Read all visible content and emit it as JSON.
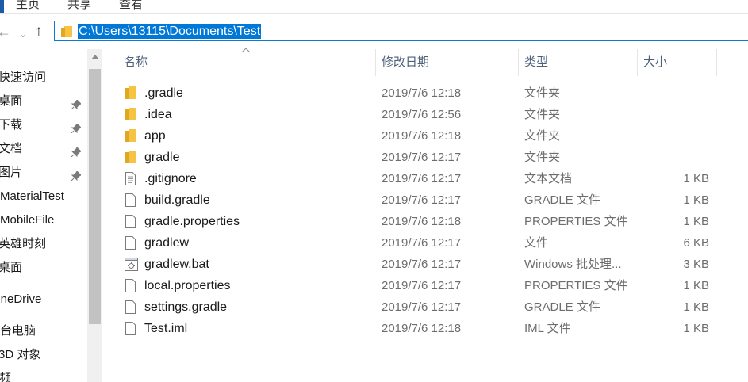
{
  "ribbon": {
    "tabs": [
      "主页",
      "共享",
      "查看"
    ]
  },
  "address": {
    "path": "C:\\Users\\13115\\Documents\\Test"
  },
  "nav_pane": {
    "items": [
      {
        "label": "快速访问",
        "pinned": false
      },
      {
        "label": "桌面",
        "pinned": true
      },
      {
        "label": "下载",
        "pinned": true
      },
      {
        "label": "文档",
        "pinned": true
      },
      {
        "label": "图片",
        "pinned": true
      },
      {
        "label": "MaterialTest",
        "pinned": false
      },
      {
        "label": "MobileFile",
        "pinned": false
      },
      {
        "label": "英雄时刻",
        "pinned": false
      },
      {
        "label": "桌面",
        "pinned": false
      },
      {
        "label": "OneDrive",
        "pinned": false
      },
      {
        "label": "此台电脑",
        "pinned": false
      },
      {
        "label": "3D 对象",
        "pinned": false
      },
      {
        "label": "视频",
        "pinned": false
      }
    ]
  },
  "columns": {
    "name": "名称",
    "date": "修改日期",
    "type": "类型",
    "size": "大小"
  },
  "files": [
    {
      "name": ".gradle",
      "date": "2019/7/6 12:18",
      "type": "文件夹",
      "size": "",
      "icon": "folder-icon"
    },
    {
      "name": ".idea",
      "date": "2019/7/6 12:56",
      "type": "文件夹",
      "size": "",
      "icon": "folder-icon"
    },
    {
      "name": "app",
      "date": "2019/7/6 12:18",
      "type": "文件夹",
      "size": "",
      "icon": "folder-icon"
    },
    {
      "name": "gradle",
      "date": "2019/7/6 12:17",
      "type": "文件夹",
      "size": "",
      "icon": "folder-icon"
    },
    {
      "name": ".gitignore",
      "date": "2019/7/6 12:17",
      "type": "文本文档",
      "size": "1 KB",
      "icon": "text-file-icon"
    },
    {
      "name": "build.gradle",
      "date": "2019/7/6 12:17",
      "type": "GRADLE 文件",
      "size": "1 KB",
      "icon": "file-icon"
    },
    {
      "name": "gradle.properties",
      "date": "2019/7/6 12:18",
      "type": "PROPERTIES 文件",
      "size": "1 KB",
      "icon": "file-icon"
    },
    {
      "name": "gradlew",
      "date": "2019/7/6 12:17",
      "type": "文件",
      "size": "6 KB",
      "icon": "file-icon"
    },
    {
      "name": "gradlew.bat",
      "date": "2019/7/6 12:17",
      "type": "Windows 批处理...",
      "size": "3 KB",
      "icon": "batch-file-icon"
    },
    {
      "name": "local.properties",
      "date": "2019/7/6 12:17",
      "type": "PROPERTIES 文件",
      "size": "1 KB",
      "icon": "file-icon"
    },
    {
      "name": "settings.gradle",
      "date": "2019/7/6 12:17",
      "type": "GRADLE 文件",
      "size": "1 KB",
      "icon": "file-icon"
    },
    {
      "name": "Test.iml",
      "date": "2019/7/6 12:18",
      "type": "IML 文件",
      "size": "1 KB",
      "icon": "file-icon"
    }
  ],
  "colors": {
    "accent": "#0078d7",
    "folder": "#f6c343",
    "header_text": "#4c607a"
  }
}
